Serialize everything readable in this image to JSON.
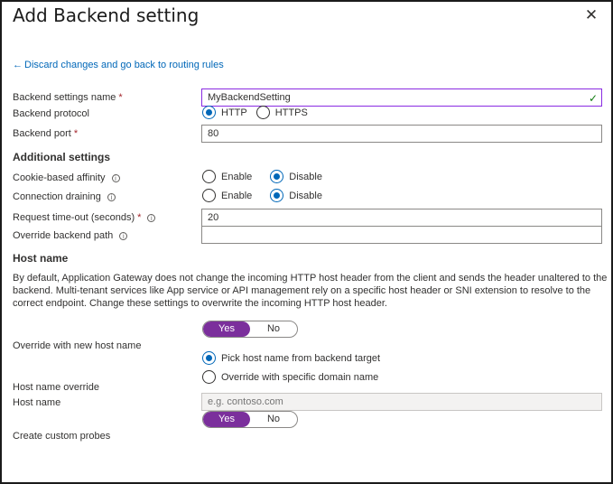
{
  "title": "Add Backend setting",
  "back_link": "Discard changes and go back to routing rules",
  "fields": {
    "name_label": "Backend settings name",
    "name_value": "MyBackendSetting",
    "protocol_label": "Backend protocol",
    "protocol_options": [
      "HTTP",
      "HTTPS"
    ],
    "port_label": "Backend port",
    "port_value": "80"
  },
  "additional": {
    "heading": "Additional settings",
    "cookie_label": "Cookie-based affinity",
    "draining_label": "Connection draining",
    "enable": "Enable",
    "disable": "Disable",
    "timeout_label": "Request time-out (seconds)",
    "timeout_value": "20",
    "override_path_label": "Override backend path",
    "override_path_value": ""
  },
  "host": {
    "heading": "Host name",
    "description": "By default, Application Gateway does not change the incoming HTTP host header from the client and sends the header unaltered to the backend. Multi-tenant services like App service or API management rely on a specific host header or SNI extension to resolve to the correct endpoint. Change these settings to overwrite the incoming HTTP host header.",
    "override_label": "Override with new host name",
    "yes": "Yes",
    "no": "No",
    "pick_option": "Pick host name from backend target",
    "specific_option": "Override with specific domain name",
    "override_name_label": "Host name override",
    "host_name_label": "Host name",
    "host_name_placeholder": "e.g. contoso.com",
    "probes_label": "Create custom probes"
  },
  "colors": {
    "accent": "#0067b8",
    "toggle_on": "#7b2f9c",
    "required": "#a4262c",
    "valid_border": "#8a2be2"
  }
}
